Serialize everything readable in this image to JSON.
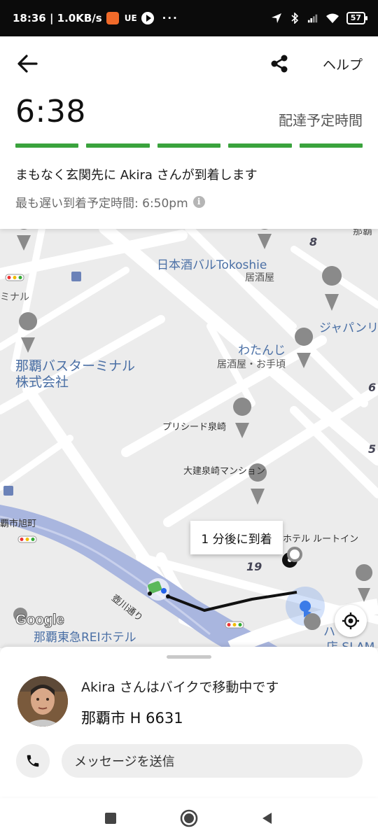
{
  "status_bar": {
    "time_speed": "18:36 | 1.0KB/s",
    "app_tag": "UE",
    "more": "···",
    "battery": "57"
  },
  "header": {
    "help_label": "ヘルプ",
    "eta_time": "6:38",
    "eta_label": "配達予定時間",
    "progress_segments": 5,
    "progress_color": "#3aa33d",
    "arrival_message": "まもなく玄関先に Akira さんが到着します",
    "latest_arrival": "最も遅い到着予定時間: 6:50pm",
    "info_glyph": "i"
  },
  "map": {
    "labels": {
      "nihonshu_bar": "日本酒バルTokoshie",
      "nihonshu_type": "居酒屋",
      "japan_partial": "ジャパンリ",
      "watanji": "わたんじ",
      "watanji_type": "居酒屋・お手頃",
      "terminal_partial": "ミナル",
      "naha_bus_1": "那覇バスターミナル",
      "naha_bus_2": "株式会社",
      "precede": "プリシード泉崎",
      "daiken": "大建泉崎マンション",
      "asahi_partial": "覇市旭町",
      "hotel_route": "ホテル ルートイン",
      "kumoji_road": "壺川通り",
      "tokyu": "那覇東急REIホテル",
      "slam": "店 SLAM",
      "ha": "ハ",
      "num_8": "8",
      "num_6": "6",
      "num_5": "5",
      "num_19": "19",
      "corner_partial": "那覇"
    },
    "eta_bubble": "1 分後に到着",
    "google_logo": "Google",
    "route_color": "#111111",
    "river_color": "#a9b6df",
    "destination_color": "#3b7be8"
  },
  "sheet": {
    "driver_status": "Akira さんはバイクで移動中です",
    "plate": "那覇市 H 6631",
    "message_placeholder": "メッセージを送信"
  }
}
